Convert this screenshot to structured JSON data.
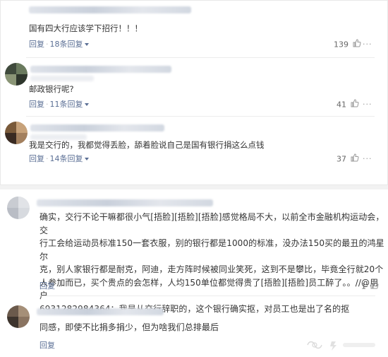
{
  "comments_top": [
    {
      "text": "国有四大行应该学下招行！！！",
      "reply": "回复",
      "sep": "·",
      "replies": "18条回复",
      "likes": "139"
    },
    {
      "text": "邮政银行呢?",
      "reply": "回复",
      "sep": "·",
      "replies": "11条回复",
      "likes": "41"
    },
    {
      "text": "我是交行的，我都觉得丢脸，舔着脸说自己是国有银行捐这么点钱",
      "reply": "回复",
      "sep": "·",
      "replies": "14条回复",
      "likes": "37"
    }
  ],
  "comments_bottom": [
    {
      "lines": [
        "确实，交行不论干嘛都很小气[捂脸][捂脸][捂脸]感觉格局不大，以前全市金融机构运动会，交",
        "行工会给运动员标准150一套衣服，别的银行都是1000的标准，没办法150买的最丑的鸿星尔",
        "克，别人家银行都是耐克，阿迪，走方阵时候被同业笑死，这到不是攀比，毕竟全行就20个",
        "人参加而已，买个贵点的会怎样，人均150单位都觉得贵了[捂脸][捂脸]员工醉了。。//@用户",
        "6931282984364：我是从交行辞职的，这个银行确实抠，对员工也是出了名的抠"
      ],
      "reply": "回复",
      "likes": "1"
    },
    {
      "lines": [
        "同感，即使不比捐多捐少，但为啥我们总排最后"
      ],
      "reply": "回复"
    }
  ],
  "icons": {
    "thumb": "thumbs-up-icon",
    "more": "more-dots-icon",
    "caret": "chevron-down-icon"
  },
  "colors": {
    "link": "#5b6f95",
    "text": "#333333",
    "divider": "#ececec"
  }
}
